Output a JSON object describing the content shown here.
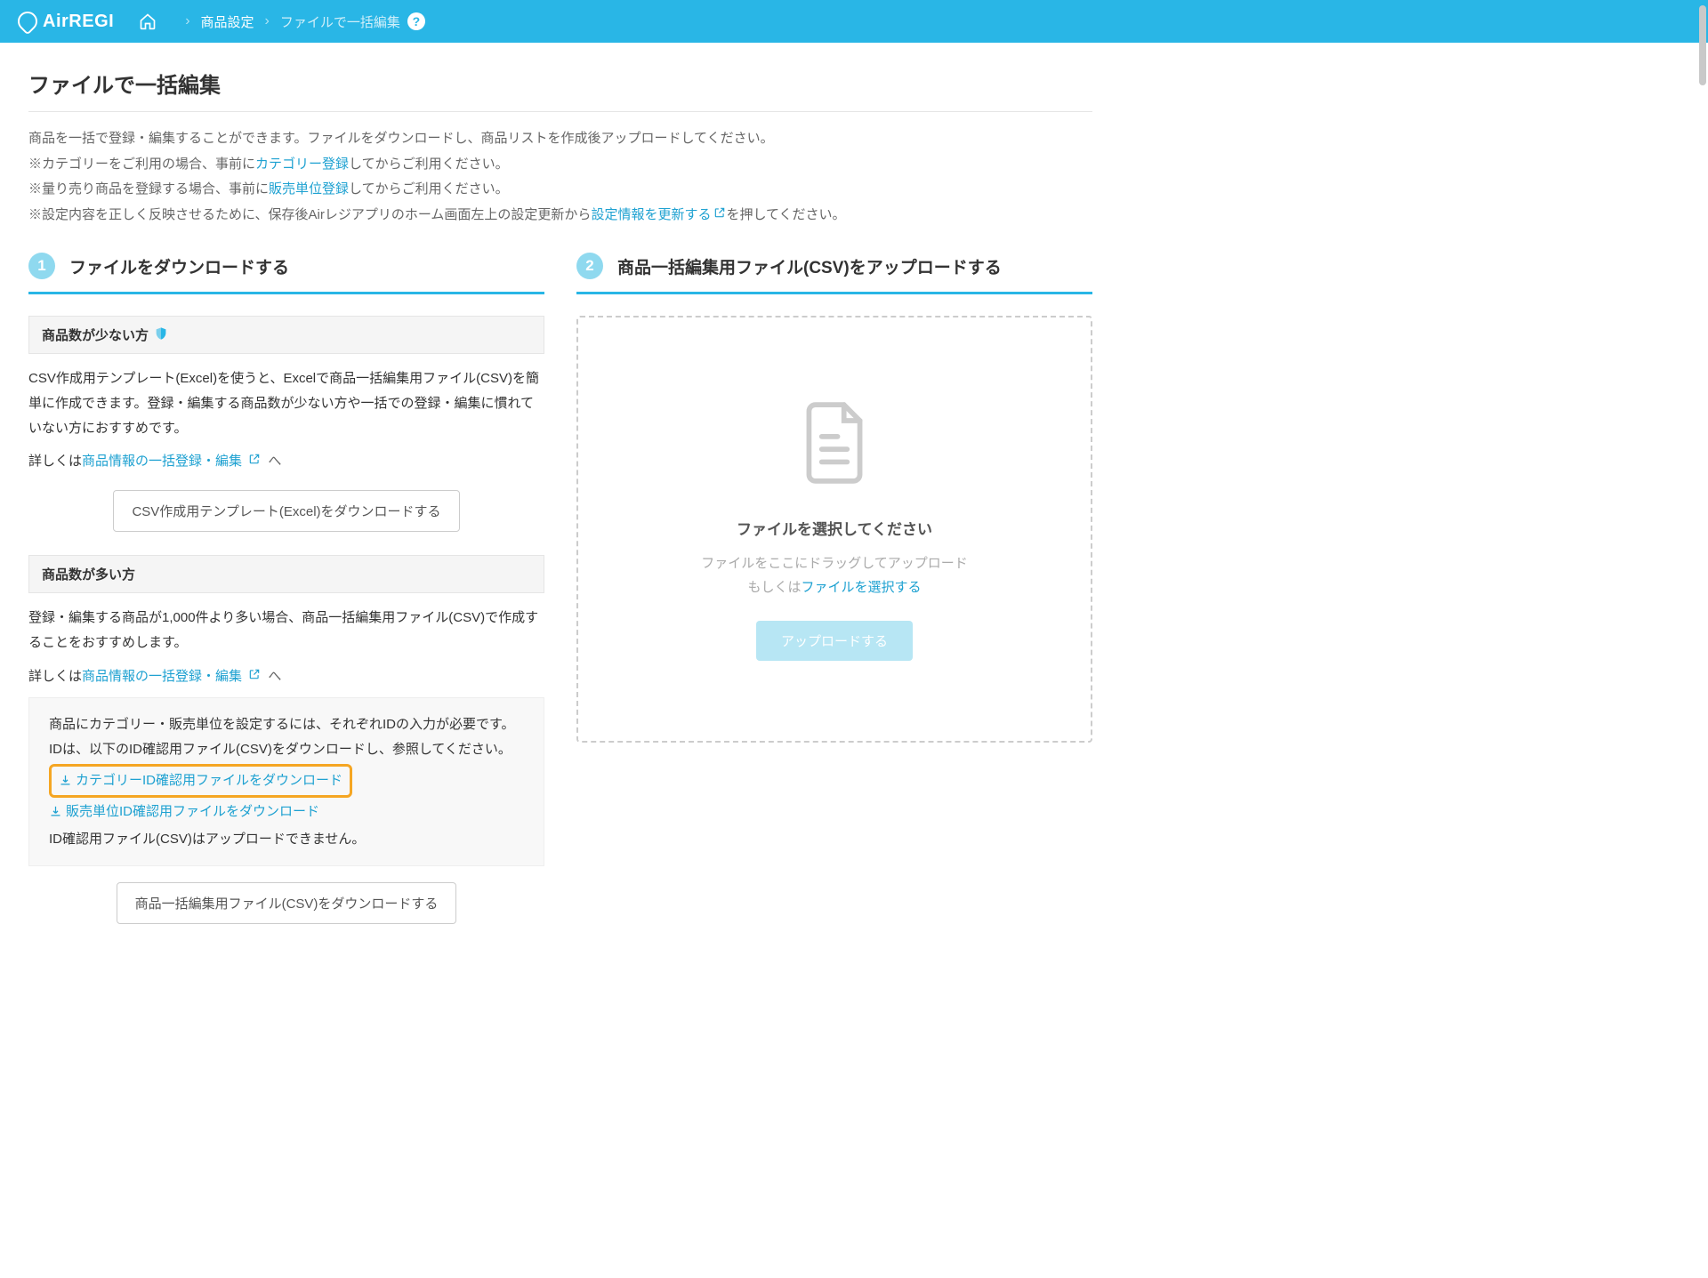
{
  "header": {
    "brand": "AirREGI",
    "breadcrumb": {
      "l1": "商品設定",
      "l2": "ファイルで一括編集"
    }
  },
  "pageTitle": "ファイルで一括編集",
  "intro": {
    "line1": "商品を一括で登録・編集することができます。ファイルをダウンロードし、商品リストを作成後アップロードしてください。",
    "line2a": "※カテゴリーをご利用の場合、事前に",
    "line2link": "カテゴリー登録",
    "line2b": "してからご利用ください。",
    "line3a": "※量り売り商品を登録する場合、事前に",
    "line3link": "販売単位登録",
    "line3b": "してからご利用ください。",
    "line4a": "※設定内容を正しく反映させるために、保存後Airレジアプリのホーム画面左上の設定更新から",
    "line4link": "設定情報を更新する",
    "line4b": "を押してください。"
  },
  "step1": {
    "num": "1",
    "title": "ファイルをダウンロードする",
    "few": {
      "bar": "商品数が少ない方",
      "p1": "CSV作成用テンプレート(Excel)を使うと、Excelで商品一括編集用ファイル(CSV)を簡単に作成できます。登録・編集する商品数が少ない方や一括での登録・編集に慣れていない方におすすめです。",
      "p2a": "詳しくは",
      "p2link": "商品情報の一括登録・編集",
      "p2b": " へ",
      "btn": "CSV作成用テンプレート(Excel)をダウンロードする"
    },
    "many": {
      "bar": "商品数が多い方",
      "p1": "登録・編集する商品が1,000件より多い場合、商品一括編集用ファイル(CSV)で作成することをおすすめします。",
      "p2a": "詳しくは",
      "p2link": "商品情報の一括登録・編集",
      "p2b": " へ",
      "box": {
        "l1": "商品にカテゴリー・販売単位を設定するには、それぞれIDの入力が必要です。",
        "l2": "IDは、以下のID確認用ファイル(CSV)をダウンロードし、参照してください。",
        "dl1": "カテゴリーID確認用ファイルをダウンロード",
        "dl2": "販売単位ID確認用ファイルをダウンロード",
        "l3": "ID確認用ファイル(CSV)はアップロードできません。"
      },
      "btn": "商品一括編集用ファイル(CSV)をダウンロードする"
    }
  },
  "step2": {
    "num": "2",
    "title": "商品一括編集用ファイル(CSV)をアップロードする",
    "uploadTitle": "ファイルを選択してください",
    "sub1": "ファイルをここにドラッグしてアップロード",
    "sub2a": "もしくは",
    "sub2link": "ファイルを選択する",
    "btn": "アップロードする"
  }
}
